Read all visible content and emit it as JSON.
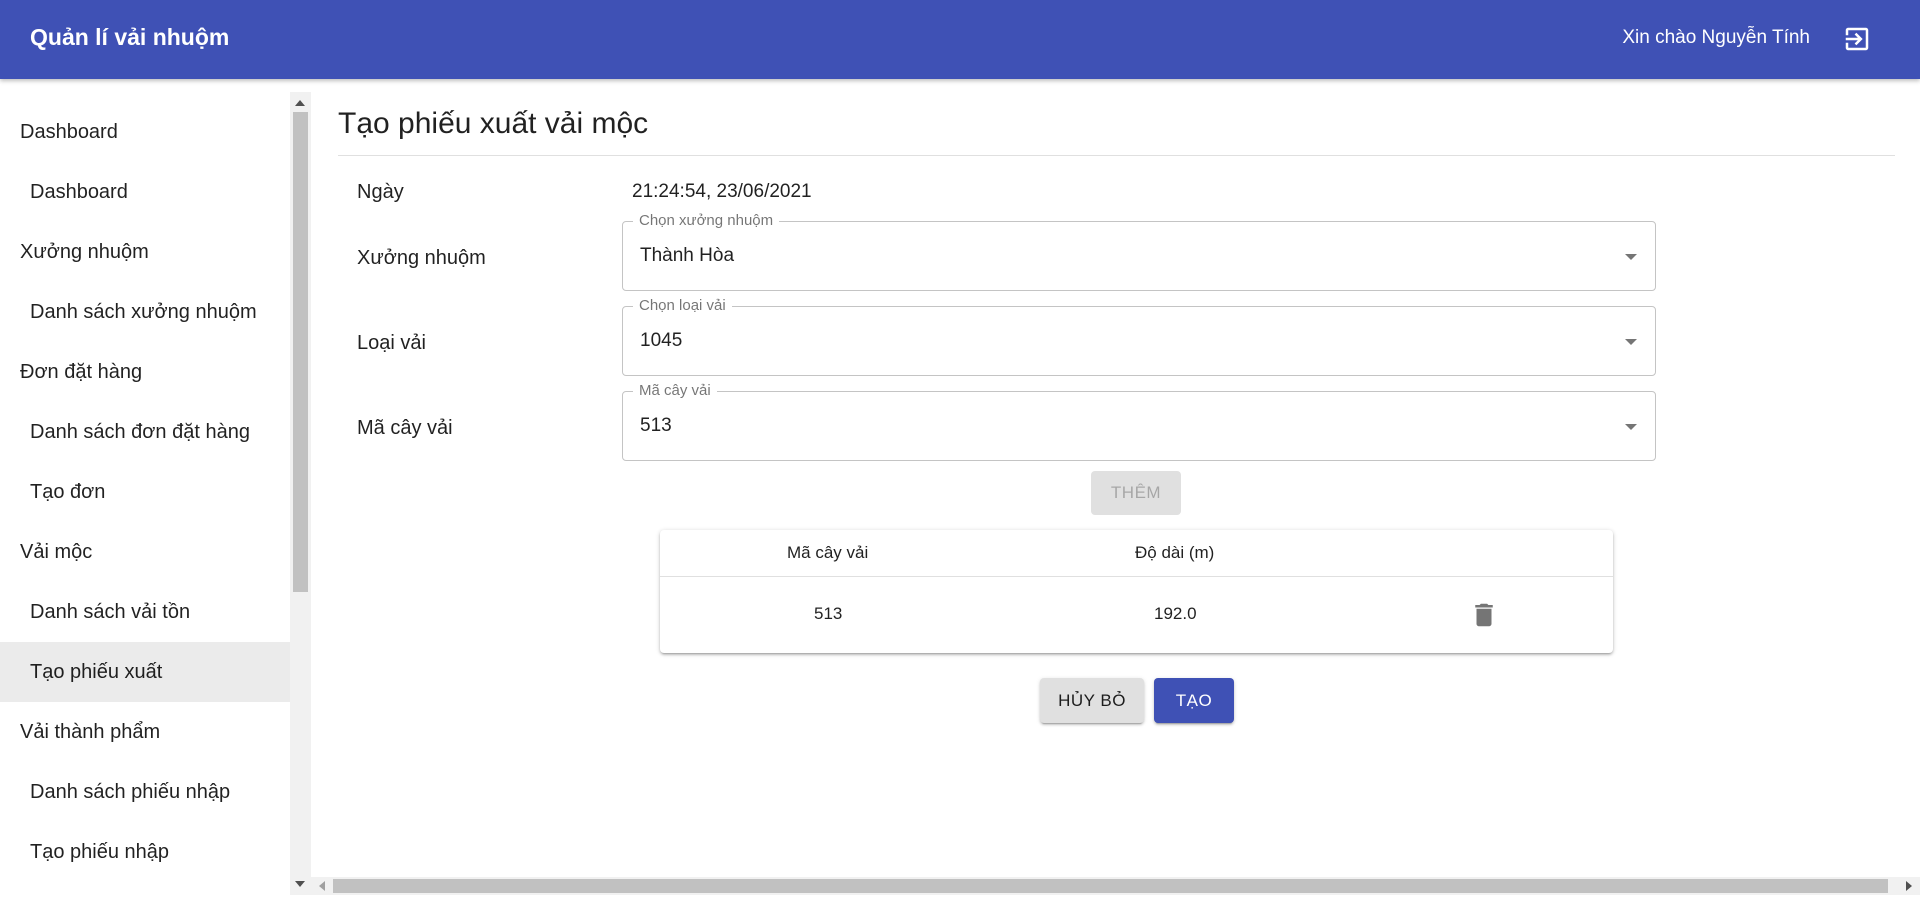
{
  "header": {
    "title": "Quản lí vải nhuộm",
    "greeting": "Xin chào Nguyễn Tính",
    "logout_icon": "logout-icon"
  },
  "sidebar": {
    "groups": [
      {
        "label": "Dashboard",
        "items": [
          {
            "label": "Dashboard"
          }
        ]
      },
      {
        "label": "Xưởng nhuộm",
        "items": [
          {
            "label": "Danh sách xưởng nhuộm"
          }
        ]
      },
      {
        "label": "Đơn đặt hàng",
        "items": [
          {
            "label": "Danh sách đơn đặt hàng"
          },
          {
            "label": "Tạo đơn"
          }
        ]
      },
      {
        "label": "Vải mộc",
        "items": [
          {
            "label": "Danh sách vải tồn"
          },
          {
            "label": "Tạo phiếu xuất",
            "active": true
          }
        ]
      },
      {
        "label": "Vải thành phẩm",
        "items": [
          {
            "label": "Danh sách phiếu nhập"
          },
          {
            "label": "Tạo phiếu nhập"
          }
        ]
      }
    ]
  },
  "main": {
    "title": "Tạo phiếu xuất vải mộc",
    "form": {
      "date": {
        "label": "Ngày",
        "value": "21:24:54, 23/06/2021"
      },
      "workshop": {
        "label": "Xưởng nhuộm",
        "legend": "Chọn xưởng nhuộm",
        "value": "Thành Hòa"
      },
      "fabric_type": {
        "label": "Loại vải",
        "legend": "Chọn loại vải",
        "value": "1045"
      },
      "roll_code": {
        "label": "Mã cây vải",
        "legend": "Mã cây vải",
        "value": "513"
      }
    },
    "add_button": "THÊM",
    "table": {
      "headers": [
        "Mã cây vải",
        "Độ dài (m)"
      ],
      "rows": [
        {
          "code": "513",
          "length": "192.0"
        }
      ]
    },
    "actions": {
      "cancel": "HỦY BỎ",
      "create": "TẠO"
    }
  },
  "colors": {
    "primary": "#3f51b5",
    "active_nav": "#ebebeb"
  }
}
